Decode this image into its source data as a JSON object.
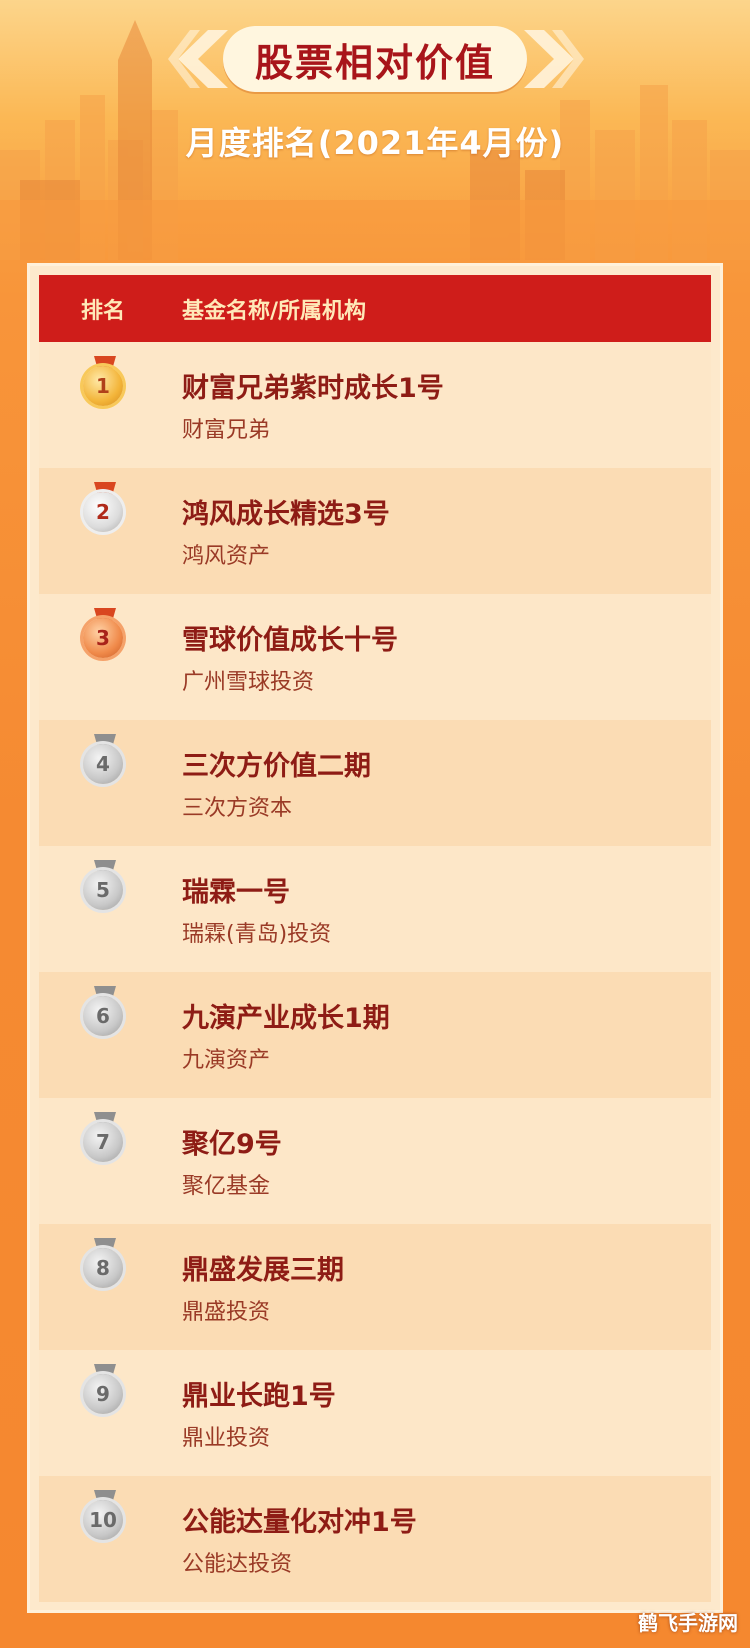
{
  "header": {
    "title": "股票相对价值",
    "subtitle": "月度排名(2021年4月份)"
  },
  "table": {
    "col_rank": "排名",
    "col_name": "基金名称/所属机构",
    "rows": [
      {
        "rank": "1",
        "name": "财富兄弟紫时成长1号",
        "org": "财富兄弟",
        "medal": "gold"
      },
      {
        "rank": "2",
        "name": "鸿风成长精选3号",
        "org": "鸿风资产",
        "medal": "silver"
      },
      {
        "rank": "3",
        "name": "雪球价值成长十号",
        "org": "广州雪球投资",
        "medal": "bronze"
      },
      {
        "rank": "4",
        "name": "三次方价值二期",
        "org": "三次方资本",
        "medal": "grey"
      },
      {
        "rank": "5",
        "name": "瑞霖一号",
        "org": "瑞霖(青岛)投资",
        "medal": "grey"
      },
      {
        "rank": "6",
        "name": "九演产业成长1期",
        "org": "九演资产",
        "medal": "grey"
      },
      {
        "rank": "7",
        "name": "聚亿9号",
        "org": "聚亿基金",
        "medal": "grey"
      },
      {
        "rank": "8",
        "name": "鼎盛发展三期",
        "org": "鼎盛投资",
        "medal": "grey"
      },
      {
        "rank": "9",
        "name": "鼎业长跑1号",
        "org": "鼎业投资",
        "medal": "grey"
      },
      {
        "rank": "10",
        "name": "公能达量化对冲1号",
        "org": "公能达投资",
        "medal": "grey"
      }
    ]
  },
  "watermark": "鹤飞手游网",
  "colors": {
    "header_red": "#cf1d1a",
    "title_red": "#a8151a",
    "name_text": "#8e1c15",
    "row_light": "#fde7c8",
    "row_dark": "#fbdcb4",
    "background_orange": "#f5882f"
  }
}
